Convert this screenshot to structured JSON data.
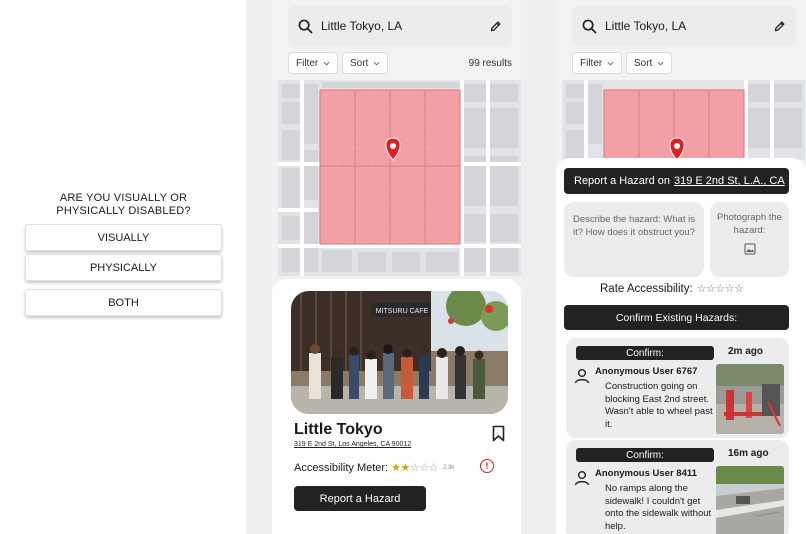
{
  "screen1": {
    "question": "ARE YOU VISUALLY OR PHYSICALLY DISABLED?",
    "options": [
      "VISUALLY",
      "PHYSICALLY",
      "BOTH"
    ]
  },
  "search": {
    "location": "Little Tokyo, LA",
    "filter_label": "Filter",
    "sort_label": "Sort",
    "results": "99 results"
  },
  "place": {
    "name": "Little Tokyo",
    "address": "319 E 2nd St, Los Angeles, CA 90012",
    "meter_label": "Accessibility Meter:",
    "rating": 2,
    "rating_max": 5,
    "review_count": "2.3k",
    "report_button": "Report a Hazard",
    "storefront_sign": "MITSURU CAFE"
  },
  "report": {
    "title_prefix": "Report a Hazard on",
    "address": "319 E 2nd St, L.A., CA",
    "describe_prompt": "Describe the hazard: What is it? How does it obstruct you?",
    "photo_prompt": "Photograph the hazard:",
    "rate_label": "Rate Accessibility:",
    "confirm_header": "Confirm Existing Hazards:",
    "hazards": [
      {
        "confirm_label": "Confirm:",
        "time": "2m ago",
        "user": "Anonymous User 6767",
        "text": "Construction going on blocking East 2nd street. Wasn't able to wheel past it."
      },
      {
        "confirm_label": "Confirm:",
        "time": "16m ago",
        "user": "Anonymous User 8411",
        "text": "No ramps along the sidewalk! I couldn't get onto the sidewalk without help."
      }
    ]
  },
  "colors": {
    "accent_dark": "#222222",
    "hazard_zone": "#f29ea3",
    "pin": "#e02020",
    "star": "#d9a400"
  }
}
